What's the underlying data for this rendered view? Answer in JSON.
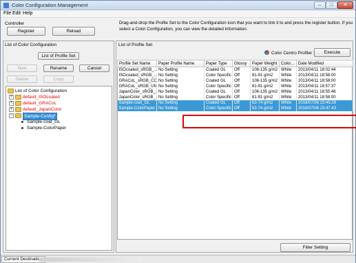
{
  "window": {
    "title": "Color Configuration Management"
  },
  "menu": {
    "items": [
      "File",
      "Edit",
      "Help"
    ]
  },
  "controller": {
    "label": "Controller",
    "register_label": "Register",
    "reload_label": "Reload"
  },
  "info_text": "Drag-and-drop the Profile Set to the Color Configuration icon that you want to link it to and press the register button. If you select a Color Configuration, you can view the detailed information.",
  "left_panel": {
    "title": "List of Color Configuration",
    "profile_set_button": "List of Profile Set",
    "buttons": {
      "new": "New",
      "rename": "Rename",
      "cancel": "Cancel",
      "delete": "Delete",
      "copy": "Copy"
    },
    "tree": {
      "root": "List of Color Configuration",
      "items": [
        {
          "label": "default_ISOcoated",
          "color": "#e00000"
        },
        {
          "label": "default_GRACoL",
          "color": "#e00000"
        },
        {
          "label": "default_JapanColor",
          "color": "#e00000"
        },
        {
          "label": "Sample-Config*"
        }
      ],
      "children": [
        "Sample-coat_GL",
        "Sample-ColorPaper"
      ]
    }
  },
  "right_panel": {
    "title": "List of Profile Set",
    "profiler_label": "Color Centro Profiler :",
    "execute_label": "Execute",
    "filter_label": "Filter Setting",
    "columns": [
      "Profile Set Name",
      "Paper Profile Name",
      "Paper Type",
      "Glossy",
      "Paper Weight",
      "Color...",
      "Date Modified"
    ],
    "rows": [
      [
        "ISOcoated_sRGB_...",
        "No Setting",
        "Coated GL",
        "Off",
        "106-135 g/m2",
        "White",
        "2013/04/11 18:02:44"
      ],
      [
        "ISOcoated_sRGB_...",
        "No Setting",
        "Color Specific",
        "Off",
        "81-91 g/m2",
        "White",
        "2013/04/11 18:58:00"
      ],
      [
        "GRACoL_sRGB_CO...",
        "No Setting",
        "Coated GL",
        "Off",
        "106-135 g/m2",
        "White",
        "2013/04/11 18:58:00"
      ],
      [
        "GRACoL_sRGB_UN...",
        "No Setting",
        "Color Specific",
        "Off",
        "81-91 g/m2",
        "White",
        "2013/04/11 18:57:37"
      ],
      [
        "JapanColor_sRGB_...",
        "No Setting",
        "Coated GL",
        "Off",
        "106-135 g/m2",
        "White",
        "2013/04/11 18:55:46"
      ],
      [
        "JapanColor_sRGB_...",
        "No Setting",
        "Color Specific",
        "Off",
        "81-91 g/m2",
        "White",
        "2013/04/11 18:58:00"
      ],
      [
        "Sample-coat_GL",
        "No Setting",
        "Coated GL",
        "Off",
        "62-74 g/m2",
        "White",
        "2016/07/06 23:45:28"
      ],
      [
        "Sample-ColorPaper",
        "No Setting",
        "Color Specific",
        "Off",
        "62-74 g/m2",
        "White",
        "2016/07/06 23:47:43"
      ]
    ],
    "selected_rows": [
      6,
      7
    ]
  },
  "status": {
    "tab": "Current Destination"
  }
}
